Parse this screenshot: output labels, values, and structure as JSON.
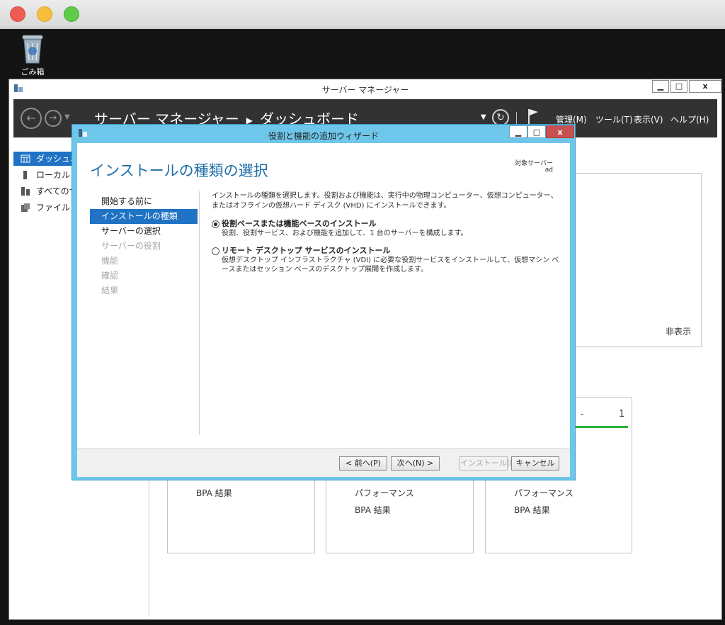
{
  "desktop": {
    "recycle_bin_label": "ごみ箱"
  },
  "server_manager": {
    "title": "サーバー マネージャー",
    "breadcrumb": {
      "root": "サーバー マネージャー",
      "current": "ダッシュボード"
    },
    "menu": [
      "管理(M)",
      "ツール(T)",
      "表示(V)",
      "ヘルプ(H)"
    ],
    "sidebar": [
      {
        "label": "ダッシュボード",
        "icon": "dashboard-icon"
      },
      {
        "label": "ローカル サーバー",
        "icon": "local-server-icon"
      },
      {
        "label": "すべてのサーバー",
        "icon": "all-servers-icon"
      },
      {
        "label": "ファイル サービスと記憶域サービス",
        "icon": "file-services-icon"
      }
    ],
    "hide_label": "非表示",
    "count_value": "1",
    "tiles": [
      {
        "lines": [
          "BPA 結果"
        ]
      },
      {
        "lines": [
          "パフォーマンス",
          "BPA 結果"
        ]
      },
      {
        "lines": [
          "パフォーマンス",
          "BPA 結果"
        ]
      }
    ]
  },
  "wizard": {
    "title": "役割と機能の追加ウィザード",
    "heading": "インストールの種類の選択",
    "target_server_label": "対象サーバー",
    "target_server_value": "ad",
    "steps": [
      {
        "label": "開始する前に",
        "state": "normal"
      },
      {
        "label": "インストールの種類",
        "state": "active"
      },
      {
        "label": "サーバーの選択",
        "state": "normal"
      },
      {
        "label": "サーバーの役割",
        "state": "disabled"
      },
      {
        "label": "機能",
        "state": "disabled"
      },
      {
        "label": "確認",
        "state": "disabled"
      },
      {
        "label": "結果",
        "state": "disabled"
      }
    ],
    "intro": "インストールの種類を選択します。役割および機能は、実行中の物理コンピューター、仮想コンピューター、またはオフラインの仮想ハード ディスク (VHD) にインストールできます。",
    "options": [
      {
        "title": "役割ベースまたは機能ベースのインストール",
        "description": "役割、役割サービス、および機能を追加して、1 台のサーバーを構成します。",
        "selected": true
      },
      {
        "title": "リモート デスクトップ サービスのインストール",
        "description": "仮想デスクトップ インフラストラクチャ (VDI) に必要な役割サービスをインストールして、仮想マシン ベースまたはセッション ベースのデスクトップ展開を作成します。",
        "selected": false
      }
    ],
    "buttons": {
      "prev": "< 前へ(P)",
      "next": "次へ(N) >",
      "install": "インストール(I)",
      "cancel": "キャンセル"
    }
  }
}
